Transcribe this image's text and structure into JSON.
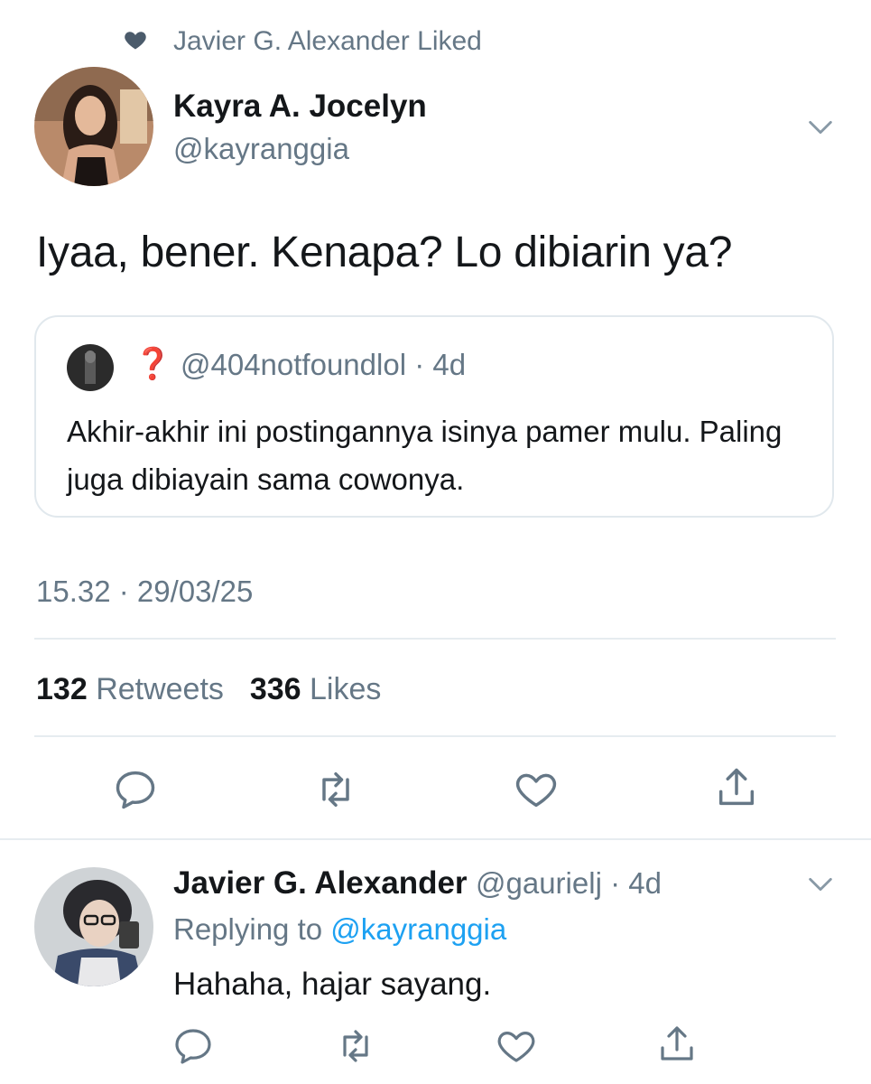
{
  "social_context": {
    "text": "Javier G. Alexander Liked",
    "icon": "heart-icon"
  },
  "tweet": {
    "author_name": "Kayra A. Jocelyn",
    "author_handle": "@kayranggia",
    "text": "Iyaa, bener. Kenapa? Lo dibiarin ya?",
    "quoted": {
      "name": "❓",
      "handle_time": "@404notfoundlol · 4d",
      "text": "Akhir-akhir ini postingannya isinya pamer mulu. Paling juga dibiayain sama cowonya."
    },
    "timestamp": "15.32 · 29/03/25",
    "retweets_count": "132",
    "retweets_label": "Retweets",
    "likes_count": "336",
    "likes_label": "Likes"
  },
  "reply": {
    "author_name": "Javier G. Alexander",
    "handle_time": "@gaurielj · 4d",
    "replying_prefix": "Replying to",
    "replying_to": "@kayranggia",
    "text": "Hahaha, hajar sayang."
  },
  "icons": [
    "heart-icon",
    "chevron-down-icon",
    "reply-icon",
    "retweet-icon",
    "like-icon",
    "share-icon"
  ],
  "colors": {
    "secondary_text": "#657786",
    "link": "#1da1f2",
    "divider": "#e6ecf0",
    "quoted_name": "#e0245e"
  }
}
